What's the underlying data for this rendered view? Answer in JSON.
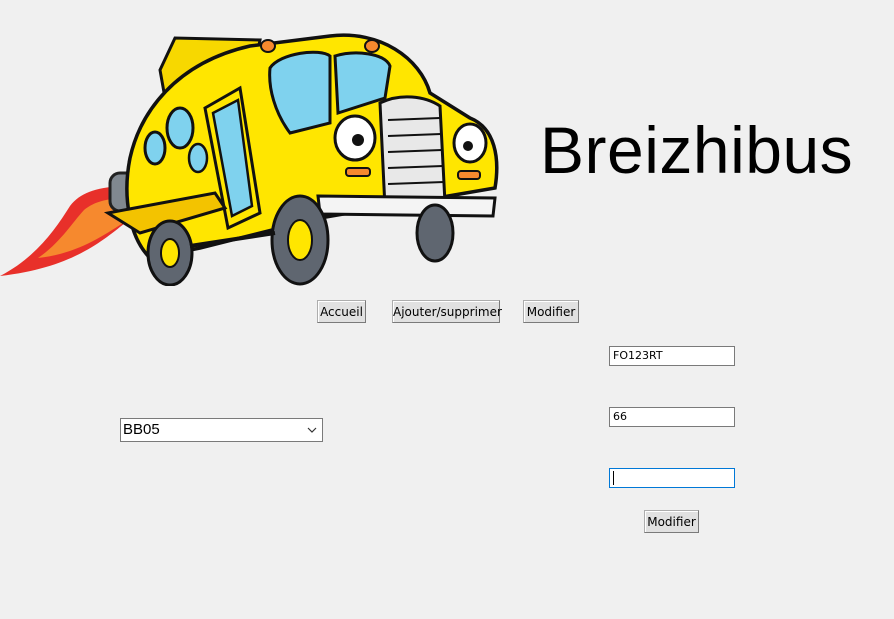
{
  "header": {
    "title": "Breizhibus"
  },
  "nav": {
    "home_label": "Accueil",
    "add_remove_label": "Ajouter/supprimer",
    "modify_label": "Modifier"
  },
  "bus_select": {
    "selected": "BB05"
  },
  "form": {
    "field1_value": "FO123RT",
    "field2_value": "66",
    "field3_value": "",
    "submit_label": "Modifier"
  },
  "colors": {
    "background": "#f0f0f0",
    "bus_yellow": "#ffe600",
    "flame_red": "#e8302a",
    "flame_orange": "#f6892e",
    "focus_border": "#0078d7"
  }
}
